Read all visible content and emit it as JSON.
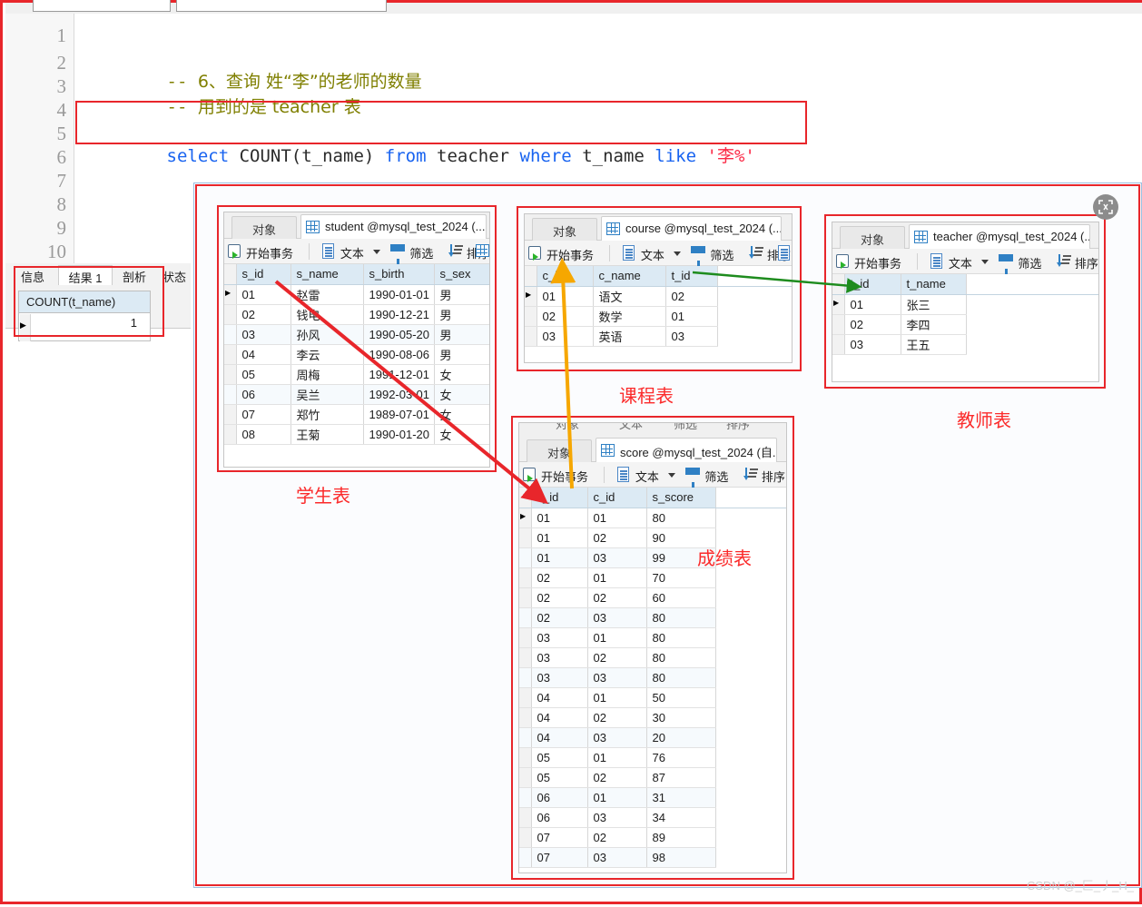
{
  "editor": {
    "line_numbers": [
      "1",
      "2",
      "3",
      "4",
      "5",
      "6",
      "7",
      "8",
      "9",
      "10"
    ],
    "lines": [
      {
        "n": 2,
        "comment_dashes": "-- ",
        "comment_text": "6、查询 姓“李”的老师的数量"
      },
      {
        "n": 3,
        "comment_dashes": "-- ",
        "comment_text": "用到的是 teacher 表"
      }
    ],
    "sql": {
      "kw_select": "select",
      "func": "COUNT(t_name)",
      "kw_from": "from",
      "table": "teacher",
      "kw_where": "where",
      "column": "t_name",
      "kw_like": "like",
      "literal": "'李%'"
    }
  },
  "result_panel": {
    "tabs": [
      "信息",
      "结果 1",
      "剖析",
      "状态"
    ],
    "active_tab": "结果 1",
    "column_header": "COUNT(t_name)",
    "value": "1"
  },
  "toolbar": {
    "start_transaction": "开始事务",
    "text": "文本",
    "filter": "筛选",
    "sort": "排序",
    "object_tab": "对象"
  },
  "icons": {
    "grid": "grid-icon",
    "transaction": "transaction-icon",
    "text": "text-file-icon",
    "filter": "funnel-icon",
    "sort": "sort-icon",
    "expand": "expand-fullscreen-icon",
    "row_marker": "current-row-marker-icon"
  },
  "panels": {
    "student": {
      "tab_title": "student @mysql_test_2024 (...",
      "caption": "学生表",
      "columns": [
        "s_id",
        "s_name",
        "s_birth",
        "s_sex"
      ],
      "rows": [
        [
          "01",
          "赵雷",
          "1990-01-01",
          "男"
        ],
        [
          "02",
          "钱电",
          "1990-12-21",
          "男"
        ],
        [
          "03",
          "孙风",
          "1990-05-20",
          "男"
        ],
        [
          "04",
          "李云",
          "1990-08-06",
          "男"
        ],
        [
          "05",
          "周梅",
          "1991-12-01",
          "女"
        ],
        [
          "06",
          "吴兰",
          "1992-03-01",
          "女"
        ],
        [
          "07",
          "郑竹",
          "1989-07-01",
          "女"
        ],
        [
          "08",
          "王菊",
          "1990-01-20",
          "女"
        ]
      ]
    },
    "course": {
      "tab_title": "course @mysql_test_2024 (...",
      "caption": "课程表",
      "columns": [
        "c_id",
        "c_name",
        "t_id"
      ],
      "rows": [
        [
          "01",
          "语文",
          "02"
        ],
        [
          "02",
          "数学",
          "01"
        ],
        [
          "03",
          "英语",
          "03"
        ]
      ]
    },
    "teacher": {
      "tab_title": "teacher @mysql_test_2024 (...",
      "caption": "教师表",
      "columns": [
        "t_id",
        "t_name"
      ],
      "rows": [
        [
          "01",
          "张三"
        ],
        [
          "02",
          "李四"
        ],
        [
          "03",
          "王五"
        ]
      ]
    },
    "score": {
      "tab_title": "score @mysql_test_2024 (自...",
      "caption": "成绩表",
      "columns": [
        "s_id",
        "c_id",
        "s_score"
      ],
      "rows": [
        [
          "01",
          "01",
          "80"
        ],
        [
          "01",
          "02",
          "90"
        ],
        [
          "01",
          "03",
          "99"
        ],
        [
          "02",
          "01",
          "70"
        ],
        [
          "02",
          "02",
          "60"
        ],
        [
          "02",
          "03",
          "80"
        ],
        [
          "03",
          "01",
          "80"
        ],
        [
          "03",
          "02",
          "80"
        ],
        [
          "03",
          "03",
          "80"
        ],
        [
          "04",
          "01",
          "50"
        ],
        [
          "04",
          "02",
          "30"
        ],
        [
          "04",
          "03",
          "20"
        ],
        [
          "05",
          "01",
          "76"
        ],
        [
          "05",
          "02",
          "87"
        ],
        [
          "06",
          "01",
          "31"
        ],
        [
          "06",
          "03",
          "34"
        ],
        [
          "07",
          "02",
          "89"
        ],
        [
          "07",
          "03",
          "98"
        ]
      ]
    }
  },
  "colors": {
    "annotation_red": "#e8262b",
    "caption_red": "#fb2a2a",
    "arrow_red": "#e8262b",
    "arrow_orange": "#f6a700",
    "arrow_green": "#1e8c1e",
    "keyword_blue": "#1863f0",
    "comment_olive": "#7f7f00",
    "string_red": "#fb2a46",
    "grid_header_blue": "#dceaf4",
    "diagram_border_blue": "#9bbee0"
  },
  "watermark": "CSDN @_匚_丿_H_"
}
